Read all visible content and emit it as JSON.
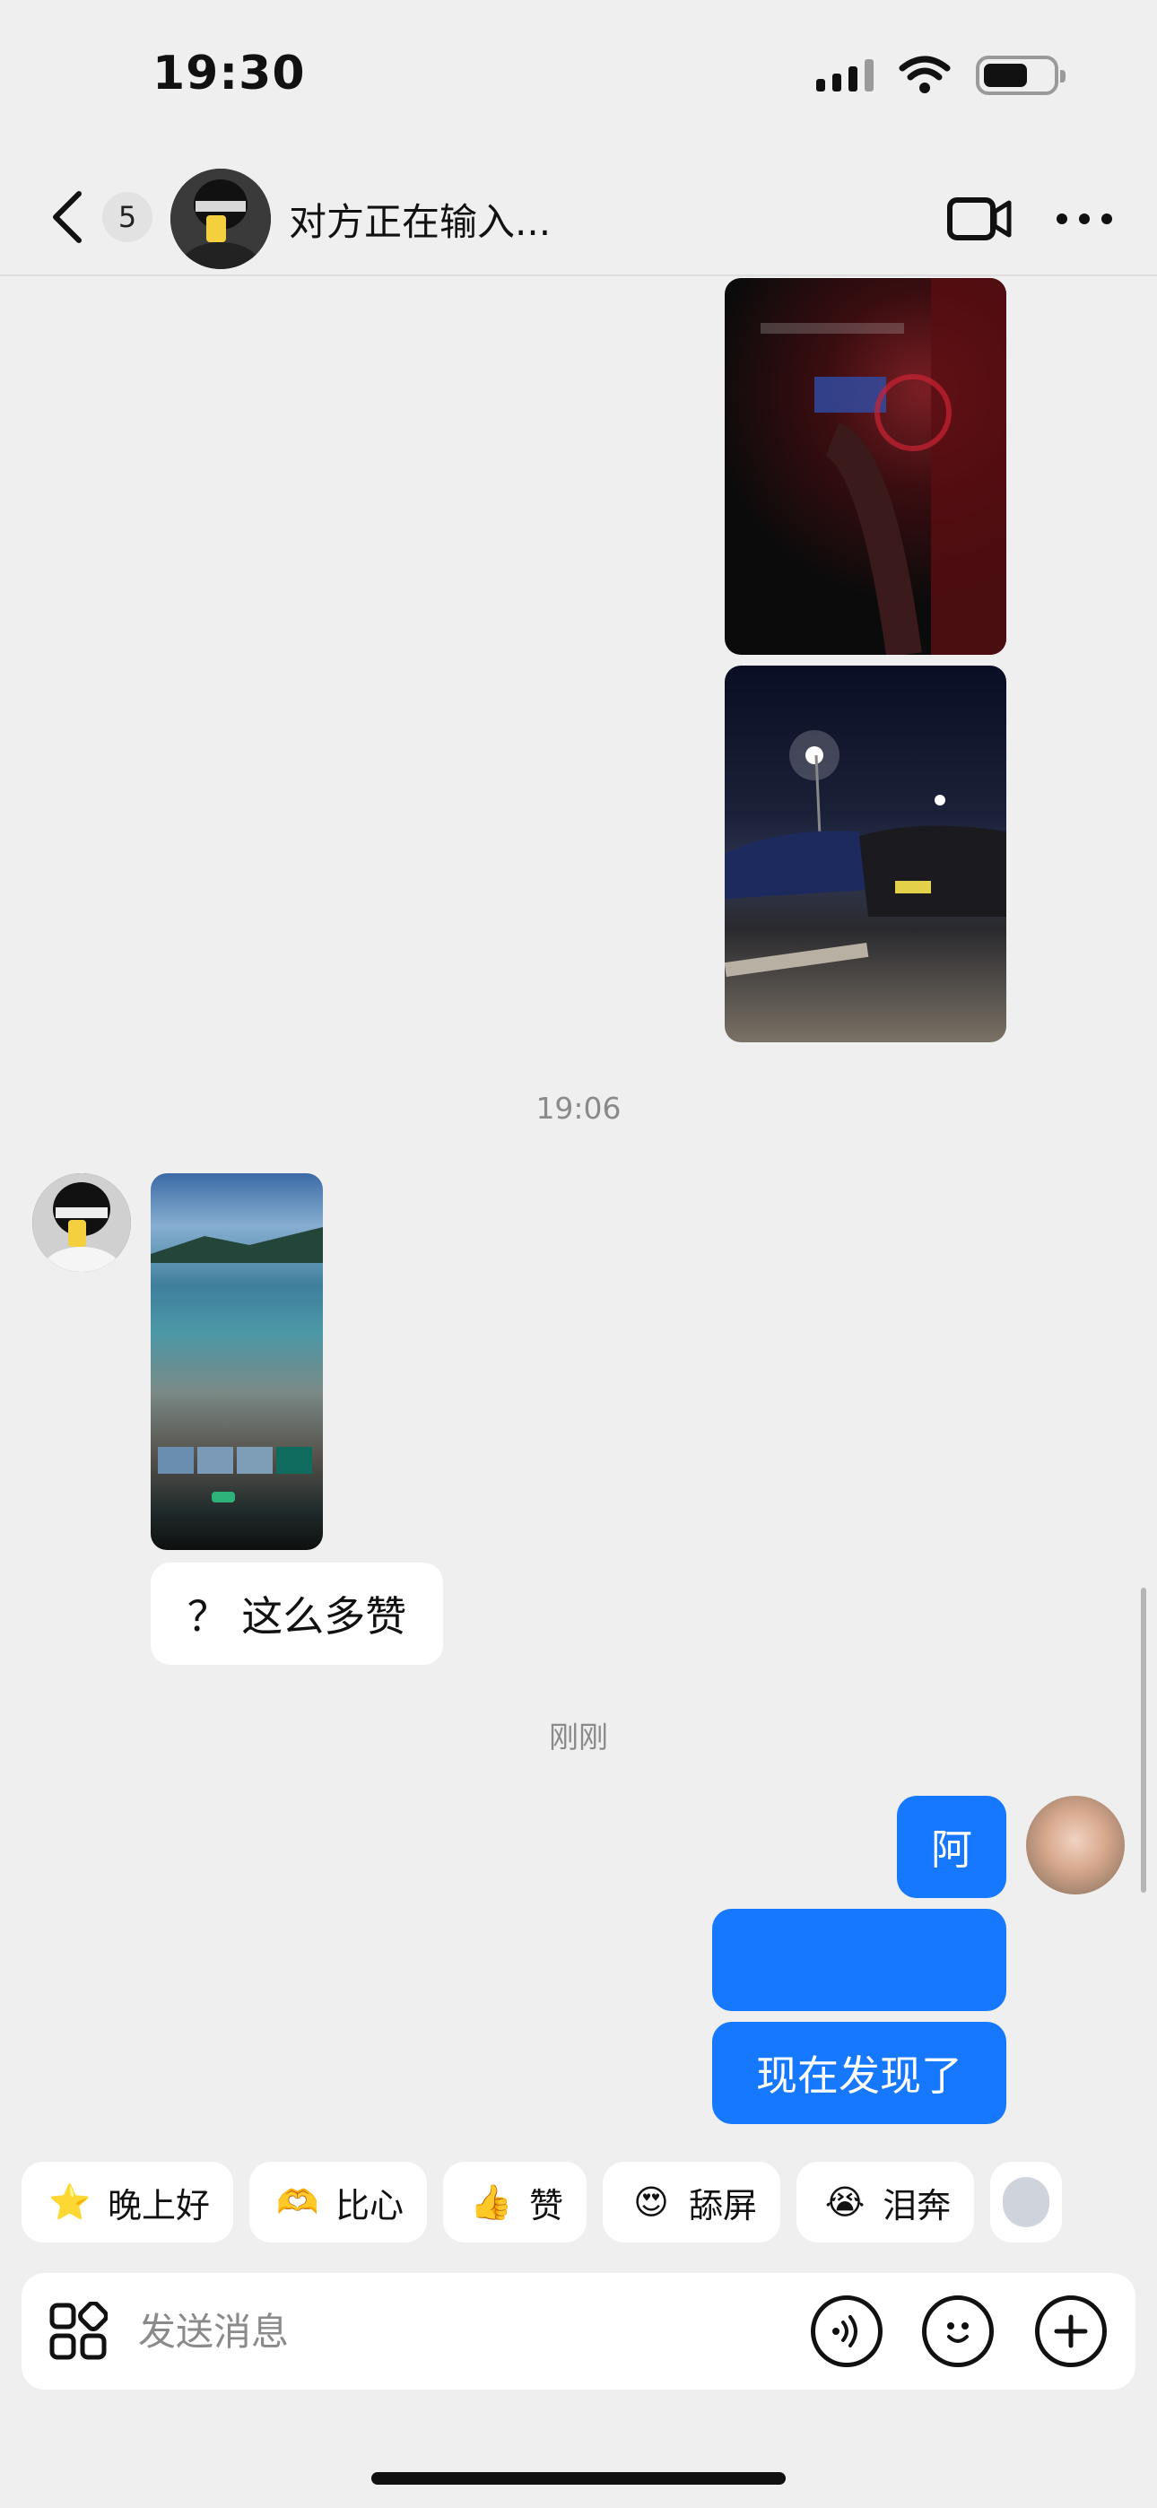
{
  "status_bar": {
    "time": "19:30"
  },
  "header": {
    "back_label": "back",
    "unread_count": "5",
    "title": "对方正在输入..."
  },
  "messages": [
    {
      "type": "time",
      "text": "19:06"
    },
    {
      "type": "text_in",
      "text": "？ 这么多赞"
    },
    {
      "type": "time",
      "text": "刚刚"
    },
    {
      "type": "text_out",
      "text": "阿"
    },
    {
      "type": "text_out",
      "text": ""
    },
    {
      "type": "text_out",
      "text": "现在发现了"
    }
  ],
  "quick_replies": [
    {
      "emoji": "⭐",
      "label": "晚上好",
      "color": "#ffcf3a"
    },
    {
      "emoji": "🫶",
      "label": "比心",
      "color": "#ffb04a"
    },
    {
      "emoji": "👍",
      "label": "赞",
      "color": "#ffc23a"
    },
    {
      "emoji": "😍",
      "label": "舔屏",
      "color": "#ff7a7a"
    },
    {
      "emoji": "😭",
      "label": "泪奔",
      "color": "#ffd04a"
    }
  ],
  "input": {
    "placeholder": "发送消息"
  },
  "colors": {
    "accent": "#1677ff",
    "background": "#efefef"
  },
  "icons": [
    "back-chevron-icon",
    "video-call-icon",
    "more-icon",
    "apps-grid-icon",
    "voice-icon",
    "emoji-icon",
    "plus-icon"
  ]
}
